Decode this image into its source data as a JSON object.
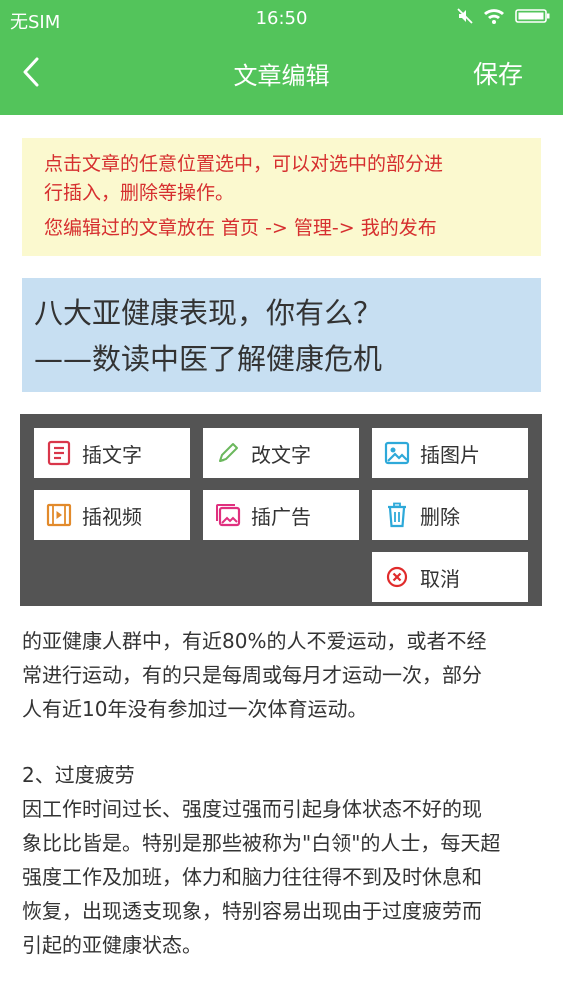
{
  "status_bar": {
    "carrier": "无SIM",
    "time": "16:50"
  },
  "app_bar": {
    "title": "文章编辑",
    "save_label": "保存"
  },
  "tip": {
    "line1": "点击文章的任意位置选中，可以对选中的部分进",
    "line2": "行插入，删除等操作。",
    "line3": "您编辑过的文章放在 首页 -> 管理-> 我的发布"
  },
  "article_title": {
    "line1": "八大亚健康表现，你有么？",
    "line2": "——数读中医了解健康危机"
  },
  "menu": {
    "insert_text": "插文字",
    "edit_text": "改文字",
    "insert_image": "插图片",
    "insert_video": "插视频",
    "insert_ad": "插广告",
    "delete": "删除",
    "cancel": "取消"
  },
  "article_body": {
    "p1": [
      "的亚健康人群中，有近80%的人不爱运动，或者不经",
      "常进行运动，有的只是每周或每月才运动一次，部分",
      "人有近10年没有参加过一次体育运动。"
    ],
    "heading2": "2、过度疲劳",
    "p2": [
      "因工作时间过长、强度过强而引起身体状态不好的现",
      "象比比皆是。特别是那些被称为\"白领\"的人士，每天超",
      "强度工作及加班，体力和脑力往往得不到及时休息和",
      "恢复，出现透支现象，特别容易出现由于过度疲劳而",
      "引起的亚健康状态。"
    ]
  },
  "colors": {
    "accent_green": "#53c45b",
    "tip_background": "#fbf9cf",
    "tip_text": "#d62f2f",
    "title_background": "#c7dff2",
    "overlay": "#545454"
  }
}
